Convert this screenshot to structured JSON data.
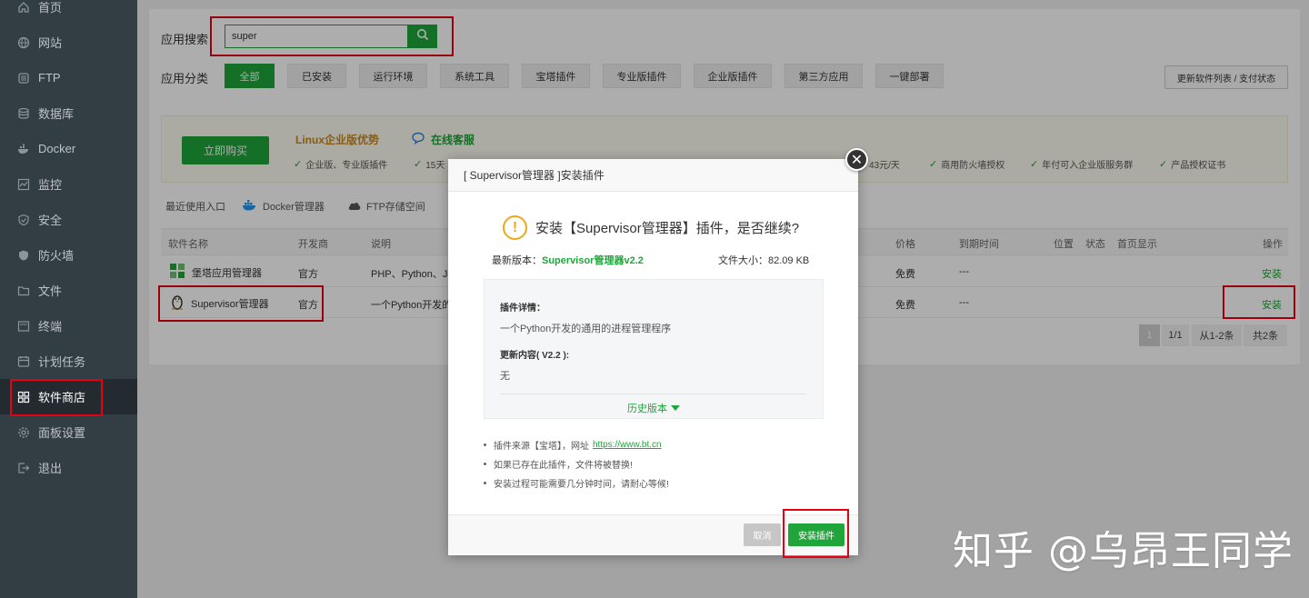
{
  "sidebar": {
    "items": [
      {
        "label": "首页",
        "icon": "home-icon"
      },
      {
        "label": "网站",
        "icon": "globe-icon"
      },
      {
        "label": "FTP",
        "icon": "ftp-icon"
      },
      {
        "label": "数据库",
        "icon": "database-icon"
      },
      {
        "label": "Docker",
        "icon": "docker-icon"
      },
      {
        "label": "监控",
        "icon": "monitor-icon"
      },
      {
        "label": "安全",
        "icon": "shield-icon"
      },
      {
        "label": "防火墙",
        "icon": "firewall-icon"
      },
      {
        "label": "文件",
        "icon": "folder-icon"
      },
      {
        "label": "终端",
        "icon": "terminal-icon"
      },
      {
        "label": "计划任务",
        "icon": "clock-icon"
      },
      {
        "label": "软件商店",
        "icon": "grid-icon"
      },
      {
        "label": "面板设置",
        "icon": "gear-icon"
      },
      {
        "label": "退出",
        "icon": "logout-icon"
      }
    ]
  },
  "search": {
    "label": "应用搜索",
    "value": "super"
  },
  "categories": {
    "label": "应用分类",
    "items": [
      "全部",
      "已安装",
      "运行环境",
      "系统工具",
      "宝塔插件",
      "专业版插件",
      "企业版插件",
      "第三方应用",
      "一键部署"
    ]
  },
  "update_button": "更新软件列表 / 支付状态",
  "promo": {
    "buy": "立即购买",
    "title": "Linux企业版优势",
    "service": "在线客服",
    "features": [
      "企业版、专业版插件",
      "15天",
      "43元/天",
      "商用防火墙授权",
      "年付可入企业版服务群",
      "产品授权证书"
    ]
  },
  "recent": {
    "label": "最近使用入口",
    "items": [
      "Docker管理器",
      "FTP存储空间"
    ]
  },
  "table": {
    "headers": [
      "软件名称",
      "开发商",
      "说明",
      "价格",
      "到期时间",
      "位置",
      "状态",
      "首页显示",
      "操作"
    ],
    "rows": [
      {
        "name": "堡塔应用管理器",
        "dev": "官方",
        "desc": "PHP、Python、Ja",
        "price": "免费",
        "expire": "---",
        "action": "安装"
      },
      {
        "name": "Supervisor管理器",
        "dev": "官方",
        "desc": "一个Python开发的",
        "price": "免费",
        "expire": "---",
        "action": "安装"
      }
    ]
  },
  "pager": {
    "current": "1",
    "pages": "1/1",
    "range": "从1-2条",
    "total": "共2条"
  },
  "modal": {
    "title": "[ Supervisor管理器 ]安装插件",
    "question": "安装【Supervisor管理器】插件，是否继续?",
    "version_label": "最新版本：",
    "version_value": "Supervisor管理器v2.2",
    "size_label": "文件大小：",
    "size_value": "82.09 KB",
    "details_label": "插件详情：",
    "details_text": "一个Python开发的通用的进程管理程序",
    "update_label": "更新内容( V2.2 ):",
    "update_text": "无",
    "history": "历史版本",
    "notes": [
      {
        "text": "插件来源【宝塔】，网址",
        "link": "https://www.bt.cn"
      },
      {
        "text": "如果已存在此插件，文件将被替换!",
        "link": ""
      },
      {
        "text": "安装过程可能需要几分钟时间，请耐心等候!",
        "link": ""
      }
    ],
    "cancel": "取消",
    "install": "安装插件"
  },
  "watermark": "知乎 @乌昂王同学",
  "colors": {
    "accent": "#20a53a",
    "sidebar": "#333d44",
    "highlight": "#e60012"
  }
}
